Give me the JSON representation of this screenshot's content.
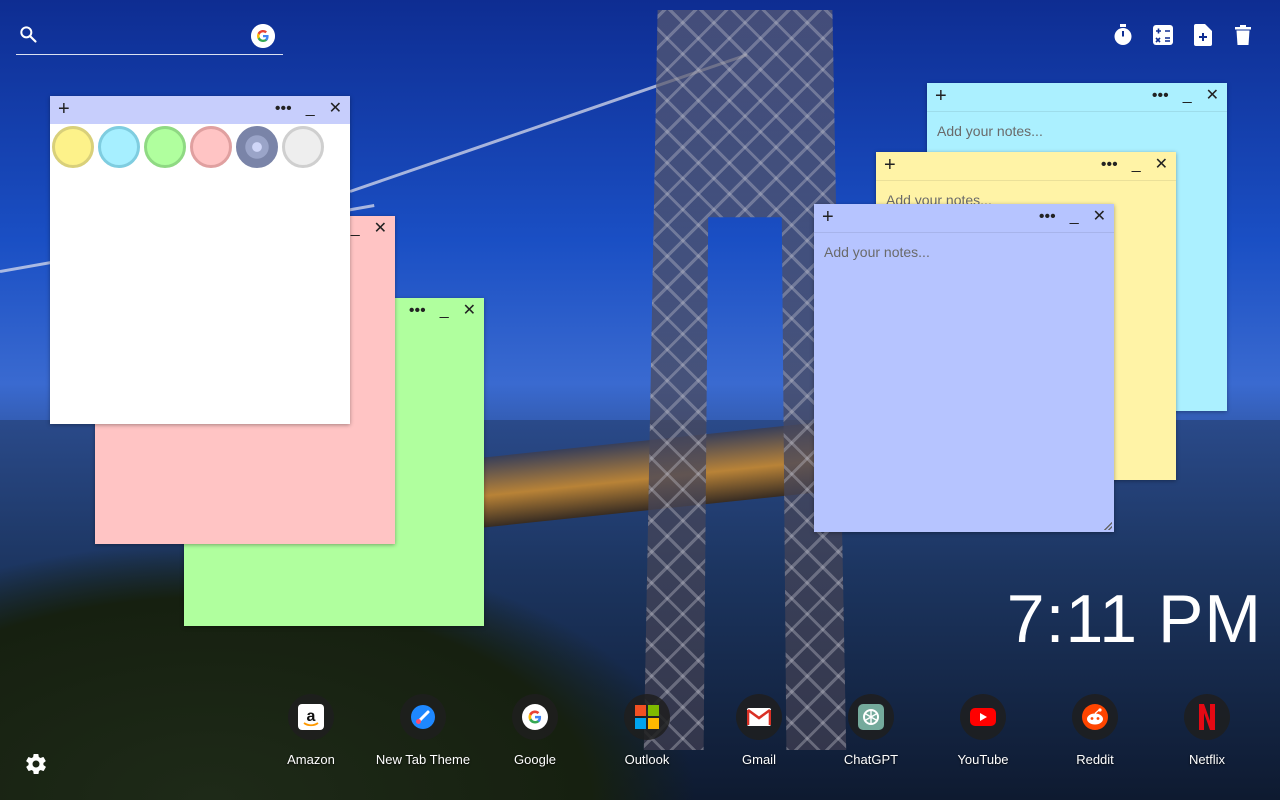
{
  "search": {
    "placeholder": "",
    "engine_icon": "google-g-icon"
  },
  "toolbar": {
    "icons": [
      "timer-icon",
      "calculator-icon",
      "new-note-icon",
      "trash-icon"
    ]
  },
  "notes": {
    "palette_colors": [
      "#fdf28a",
      "#a6efff",
      "#b0ff9e",
      "#ffc4c4",
      "#9aa4c8",
      "#eeeeee"
    ],
    "placeholder": "Add your notes...",
    "add_label": "+",
    "more_label": "•••",
    "minimize_label": "_",
    "close_label": "✕"
  },
  "clock": {
    "time": "7:11 PM"
  },
  "shortcuts": [
    {
      "label": "Amazon",
      "icon": "amazon-icon"
    },
    {
      "label": "New Tab Theme",
      "icon": "new-tab-theme-icon"
    },
    {
      "label": "Google",
      "icon": "google-icon"
    },
    {
      "label": "Outlook",
      "icon": "outlook-icon"
    },
    {
      "label": "Gmail",
      "icon": "gmail-icon"
    },
    {
      "label": "ChatGPT",
      "icon": "chatgpt-icon"
    },
    {
      "label": "YouTube",
      "icon": "youtube-icon"
    },
    {
      "label": "Reddit",
      "icon": "reddit-icon"
    },
    {
      "label": "Netflix",
      "icon": "netflix-icon"
    }
  ],
  "colors": {
    "note_header_blue": "#c7cefc",
    "pink": "#ffc4c4",
    "green": "#b0ff9e",
    "cyan": "#abf0ff",
    "yellow": "#fff3a6",
    "blue": "#b6c4ff"
  }
}
